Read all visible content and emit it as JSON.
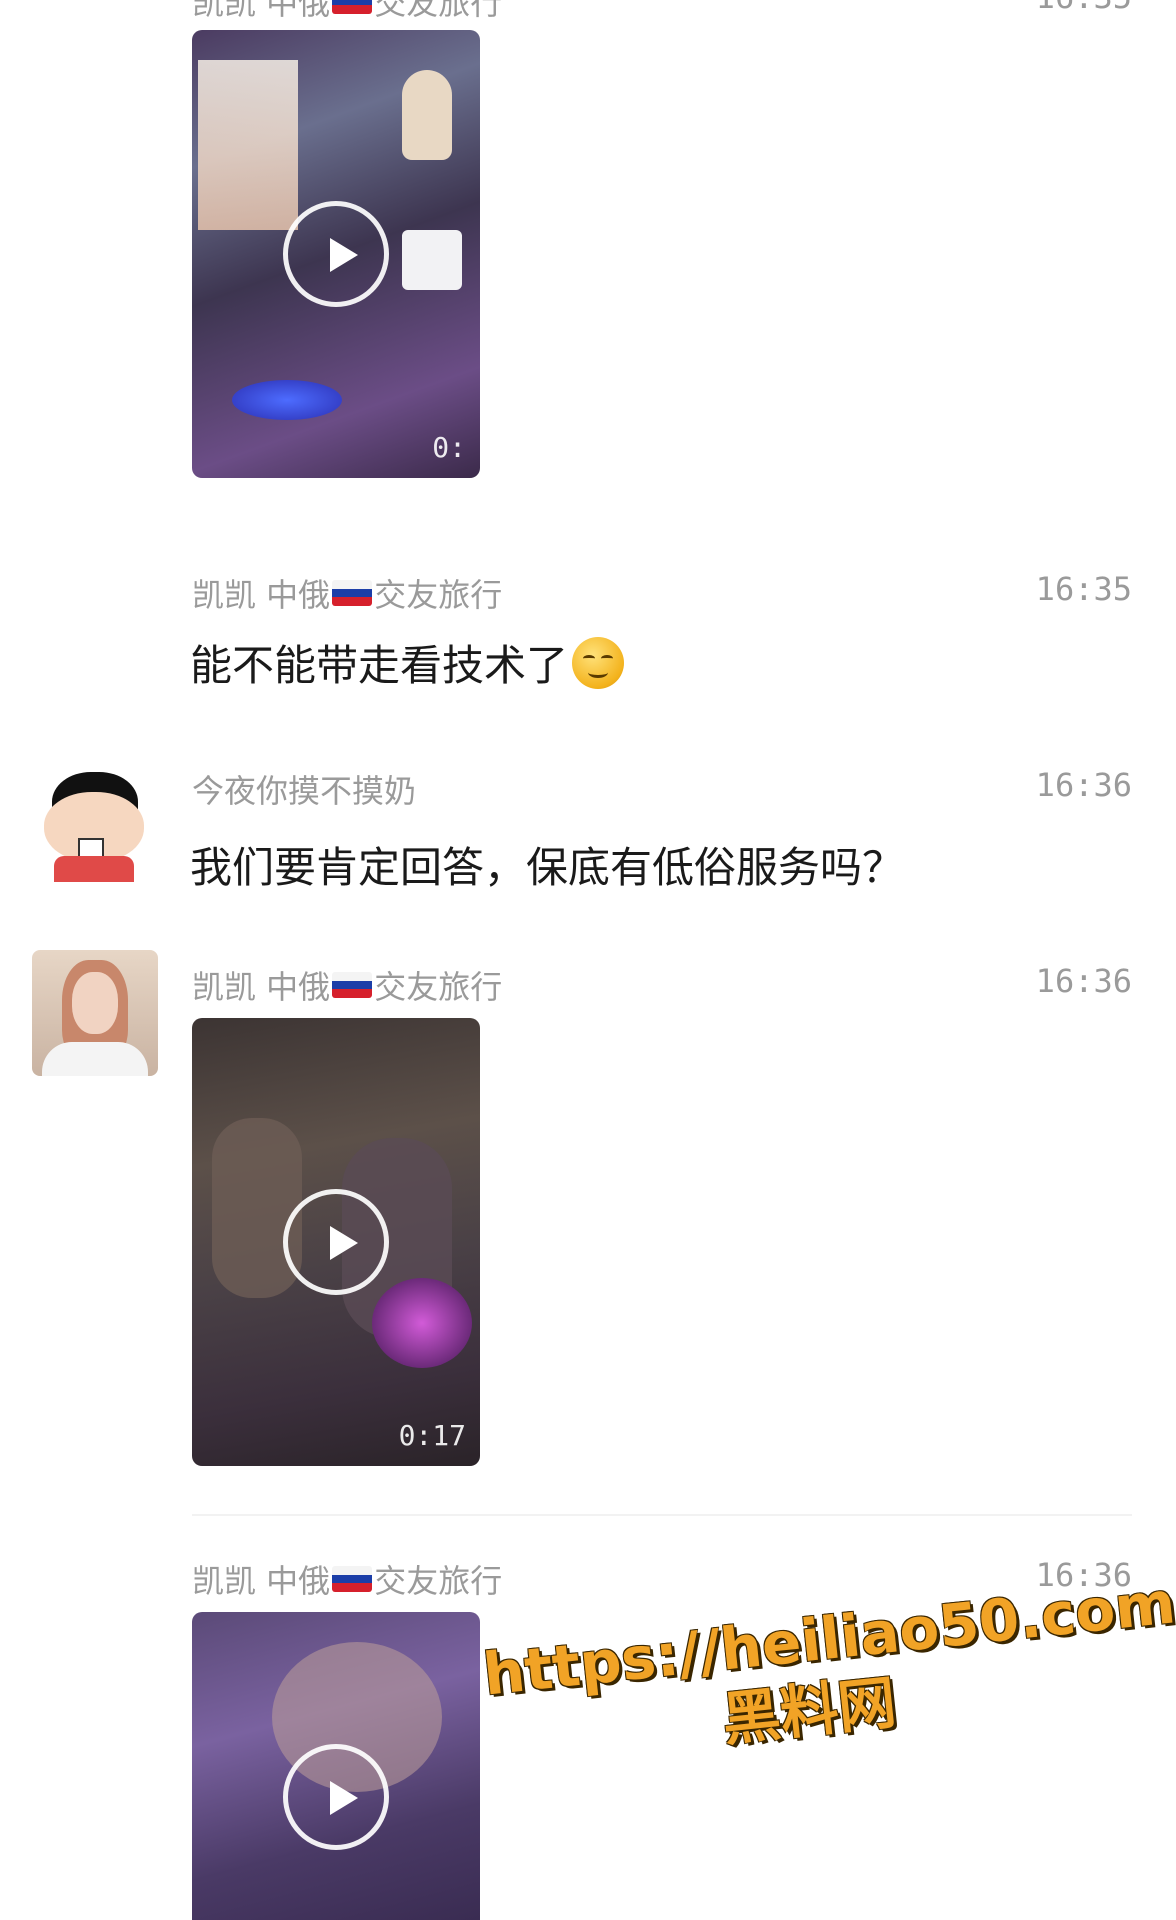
{
  "messages": [
    {
      "sender": "凯凯 中俄",
      "sender_suffix": "交友旅行",
      "time": "16:35",
      "type": "video",
      "duration": "0:"
    },
    {
      "sender": "凯凯 中俄",
      "sender_suffix": "交友旅行",
      "time": "16:35",
      "type": "text",
      "text": "能不能带走看技术了",
      "emoji": "smiling-face-emoji"
    },
    {
      "sender": "今夜你摸不摸奶",
      "time": "16:36",
      "type": "text",
      "text": "我们要肯定回答，保底有低俗服务吗？",
      "avatar": "cartoon-boy-avatar"
    },
    {
      "sender": "凯凯 中俄",
      "sender_suffix": "交友旅行",
      "time": "16:36",
      "type": "video",
      "duration": "0:17",
      "avatar": "woman-photo-avatar"
    },
    {
      "sender": "凯凯 中俄",
      "sender_suffix": "交友旅行",
      "time": "16:36",
      "type": "video",
      "duration": ""
    }
  ],
  "watermark": {
    "line1": "https://heiliao50.com",
    "line2": "黑料网"
  },
  "colors": {
    "background": "#ffffff",
    "name_time_gray": "#9a9a9a",
    "text": "#1a1a1a",
    "watermark": "#f1a326"
  }
}
